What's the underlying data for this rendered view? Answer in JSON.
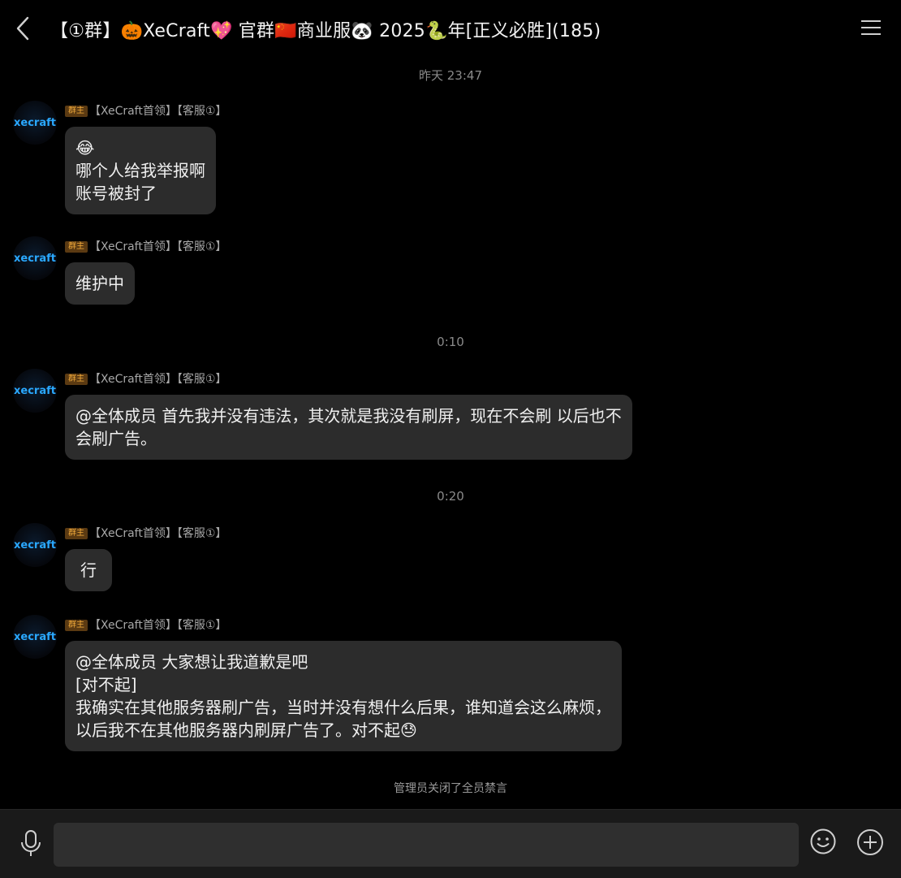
{
  "header": {
    "title": "【①群】🎃XeCraft💖 官群🇨🇳商业服🐼 2025🐍年[正义必胜](185)"
  },
  "messages": [
    {
      "role_badge": "群主",
      "sender": "【XeCraft首领】【客服①】",
      "lines": [
        "😂",
        "哪个人给我举报啊",
        "账号被封了"
      ]
    },
    {
      "role_badge": "群主",
      "sender": "【XeCraft首领】【客服①】",
      "lines": [
        "维护中"
      ]
    },
    {
      "role_badge": "群主",
      "sender": "【XeCraft首领】【客服①】",
      "lines": [
        "@全体成员 首先我并没有违法，其次就是我没有刷屏，现在不会刷 以后也不",
        "会刷广告。"
      ]
    },
    {
      "role_badge": "群主",
      "sender": "【XeCraft首领】【客服①】",
      "lines": [
        "行"
      ]
    },
    {
      "role_badge": "群主",
      "sender": "【XeCraft首领】【客服①】",
      "lines": [
        "@全体成员 大家想让我道歉是吧",
        "[对不起]",
        "我确实在其他服务器刷广告，当时并没有想什么后果，谁知道会这么麻烦，",
        "以后我不在其他服务器内刷屏广告了。对不起😓"
      ]
    }
  ],
  "timestamps": [
    "昨天 23:47",
    "0:10",
    "0:20"
  ],
  "avatar_text": "xecraft",
  "system_notice": "管理员关闭了全员禁言",
  "input": {
    "value": "",
    "placeholder": ""
  },
  "colors": {
    "background": "#000000",
    "bubble": "#2c2c2c",
    "badge_bg": "#5b3a12",
    "badge_text": "#f0a93a",
    "avatar_text": "#2aa8ff"
  },
  "icons": [
    "back-arrow-icon",
    "menu-icon",
    "microphone-icon",
    "emoji-icon",
    "plus-icon"
  ]
}
